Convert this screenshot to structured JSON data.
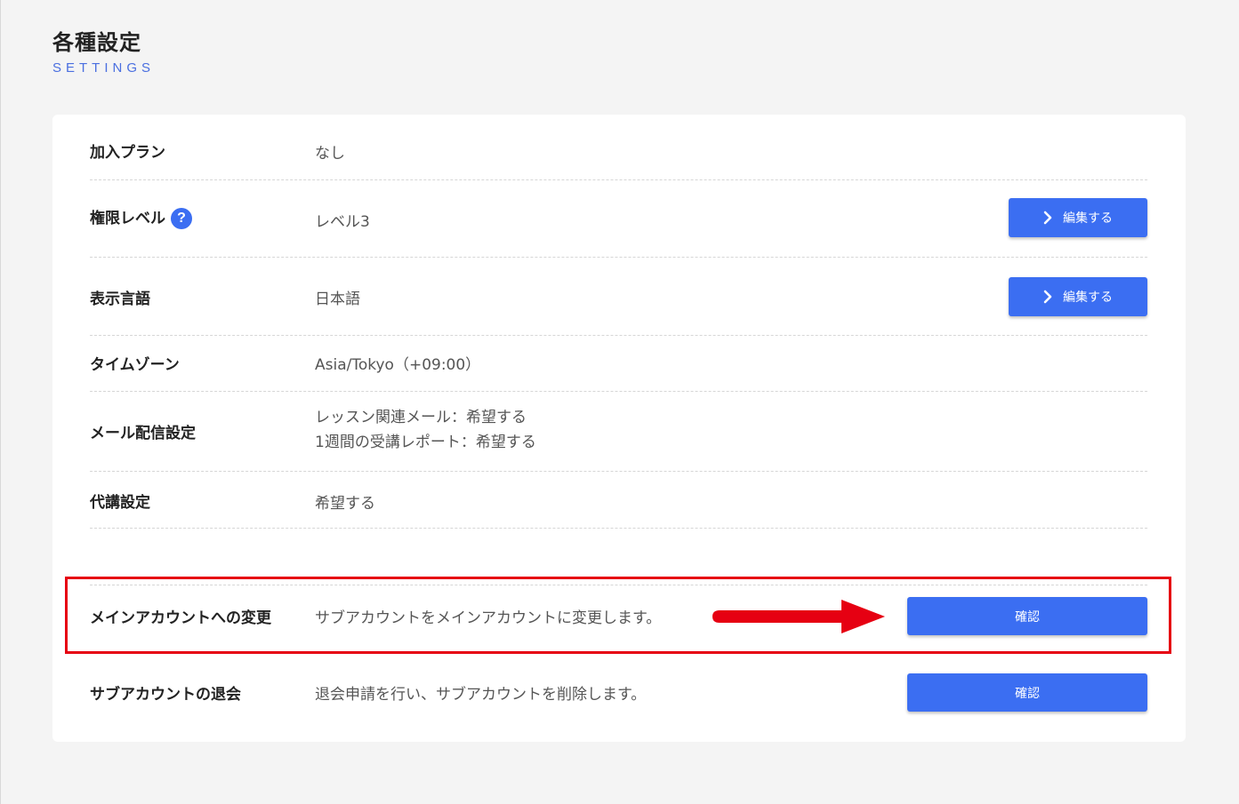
{
  "header": {
    "title": "各種設定",
    "subtitle": "SETTINGS"
  },
  "settings": {
    "plan": {
      "label": "加入プラン",
      "value": "なし"
    },
    "permission": {
      "label": "権限レベル",
      "help": "?",
      "value": "レベル3",
      "button": "編集する"
    },
    "language": {
      "label": "表示言語",
      "value": "日本語",
      "button": "編集する"
    },
    "timezone": {
      "label": "タイムゾーン",
      "value": "Asia/Tokyo（+09:00）"
    },
    "mail": {
      "label": "メール配信設定",
      "values": [
        "レッスン関連メール：希望する",
        "1週間の受講レポート：希望する"
      ]
    },
    "substitute": {
      "label": "代講設定",
      "value": "希望する"
    }
  },
  "account": {
    "main_change": {
      "label": "メインアカウントへの変更",
      "value": "サブアカウントをメインアカウントに変更します。",
      "button": "確認"
    },
    "withdraw": {
      "label": "サブアカウントの退会",
      "value": "退会申請を行い、サブアカウントを削除します。",
      "button": "確認"
    }
  },
  "colors": {
    "accent": "#3b6ef2",
    "highlight": "#e60012"
  },
  "icons": {
    "help": "question-circle-icon",
    "chevron": "chevron-right-icon",
    "annotation": "red-arrow-icon"
  }
}
